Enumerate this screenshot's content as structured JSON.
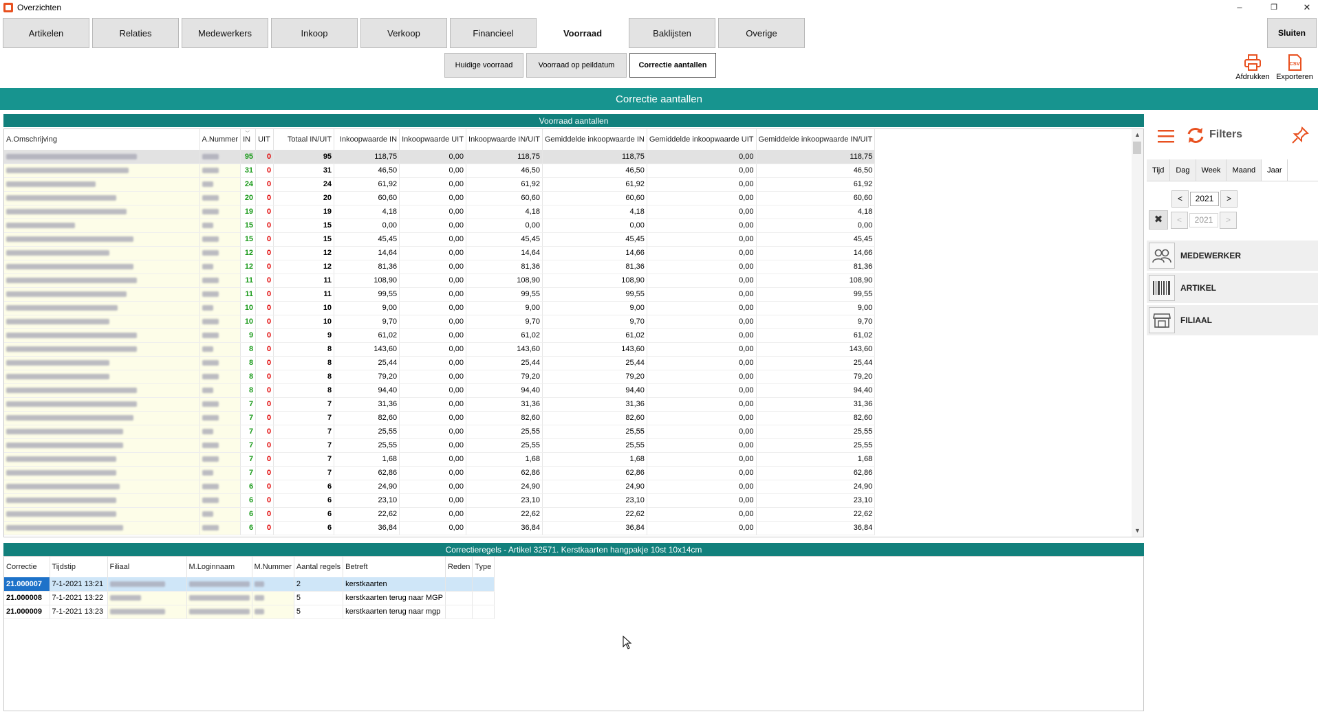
{
  "window": {
    "title": "Overzichten",
    "minimize": "–",
    "restore": "❐",
    "close": "✕"
  },
  "nav": {
    "tabs": [
      "Artikelen",
      "Relaties",
      "Medewerkers",
      "Inkoop",
      "Verkoop",
      "Financieel",
      "Voorraad",
      "Baklijsten",
      "Overige"
    ],
    "active": "Voorraad",
    "close_label": "Sluiten"
  },
  "subnav": {
    "tabs": [
      "Huidige voorraad",
      "Voorraad op peildatum",
      "Correctie aantallen"
    ],
    "active": "Correctie aantallen"
  },
  "actions": {
    "print": "Afdrukken",
    "export": "Exporteren",
    "export_icon_text": "CSV"
  },
  "header": {
    "title": "Correctie aantallen"
  },
  "stock": {
    "title": "Voorraad aantallen",
    "columns": [
      "A.Omschrijving",
      "A.Nummer",
      "IN",
      "UIT",
      "Totaal IN/UIT",
      "Inkoopwaarde IN",
      "Inkoopwaarde UIT",
      "Inkoopwaarde IN/UIT",
      "Gemiddelde inkoopwaarde IN",
      "Gemiddelde inkoopwaarde UIT",
      "Gemiddelde inkoopwaarde IN/UIT"
    ],
    "rows": [
      {
        "in": "95",
        "uit": "0",
        "tot": "95",
        "iv_in": "118,75",
        "iv_uit": "0,00",
        "iv_inuit": "118,75",
        "g_in": "118,75",
        "g_uit": "0,00",
        "g_inuit": "118,75"
      },
      {
        "in": "31",
        "uit": "0",
        "tot": "31",
        "iv_in": "46,50",
        "iv_uit": "0,00",
        "iv_inuit": "46,50",
        "g_in": "46,50",
        "g_uit": "0,00",
        "g_inuit": "46,50"
      },
      {
        "in": "24",
        "uit": "0",
        "tot": "24",
        "iv_in": "61,92",
        "iv_uit": "0,00",
        "iv_inuit": "61,92",
        "g_in": "61,92",
        "g_uit": "0,00",
        "g_inuit": "61,92"
      },
      {
        "in": "20",
        "uit": "0",
        "tot": "20",
        "iv_in": "60,60",
        "iv_uit": "0,00",
        "iv_inuit": "60,60",
        "g_in": "60,60",
        "g_uit": "0,00",
        "g_inuit": "60,60"
      },
      {
        "in": "19",
        "uit": "0",
        "tot": "19",
        "iv_in": "4,18",
        "iv_uit": "0,00",
        "iv_inuit": "4,18",
        "g_in": "4,18",
        "g_uit": "0,00",
        "g_inuit": "4,18"
      },
      {
        "in": "15",
        "uit": "0",
        "tot": "15",
        "iv_in": "0,00",
        "iv_uit": "0,00",
        "iv_inuit": "0,00",
        "g_in": "0,00",
        "g_uit": "0,00",
        "g_inuit": "0,00"
      },
      {
        "in": "15",
        "uit": "0",
        "tot": "15",
        "iv_in": "45,45",
        "iv_uit": "0,00",
        "iv_inuit": "45,45",
        "g_in": "45,45",
        "g_uit": "0,00",
        "g_inuit": "45,45"
      },
      {
        "in": "12",
        "uit": "0",
        "tot": "12",
        "iv_in": "14,64",
        "iv_uit": "0,00",
        "iv_inuit": "14,64",
        "g_in": "14,66",
        "g_uit": "0,00",
        "g_inuit": "14,66"
      },
      {
        "in": "12",
        "uit": "0",
        "tot": "12",
        "iv_in": "81,36",
        "iv_uit": "0,00",
        "iv_inuit": "81,36",
        "g_in": "81,36",
        "g_uit": "0,00",
        "g_inuit": "81,36"
      },
      {
        "in": "11",
        "uit": "0",
        "tot": "11",
        "iv_in": "108,90",
        "iv_uit": "0,00",
        "iv_inuit": "108,90",
        "g_in": "108,90",
        "g_uit": "0,00",
        "g_inuit": "108,90"
      },
      {
        "in": "11",
        "uit": "0",
        "tot": "11",
        "iv_in": "99,55",
        "iv_uit": "0,00",
        "iv_inuit": "99,55",
        "g_in": "99,55",
        "g_uit": "0,00",
        "g_inuit": "99,55"
      },
      {
        "in": "10",
        "uit": "0",
        "tot": "10",
        "iv_in": "9,00",
        "iv_uit": "0,00",
        "iv_inuit": "9,00",
        "g_in": "9,00",
        "g_uit": "0,00",
        "g_inuit": "9,00"
      },
      {
        "in": "10",
        "uit": "0",
        "tot": "10",
        "iv_in": "9,70",
        "iv_uit": "0,00",
        "iv_inuit": "9,70",
        "g_in": "9,70",
        "g_uit": "0,00",
        "g_inuit": "9,70"
      },
      {
        "in": "9",
        "uit": "0",
        "tot": "9",
        "iv_in": "61,02",
        "iv_uit": "0,00",
        "iv_inuit": "61,02",
        "g_in": "61,02",
        "g_uit": "0,00",
        "g_inuit": "61,02"
      },
      {
        "in": "8",
        "uit": "0",
        "tot": "8",
        "iv_in": "143,60",
        "iv_uit": "0,00",
        "iv_inuit": "143,60",
        "g_in": "143,60",
        "g_uit": "0,00",
        "g_inuit": "143,60"
      },
      {
        "in": "8",
        "uit": "0",
        "tot": "8",
        "iv_in": "25,44",
        "iv_uit": "0,00",
        "iv_inuit": "25,44",
        "g_in": "25,44",
        "g_uit": "0,00",
        "g_inuit": "25,44"
      },
      {
        "in": "8",
        "uit": "0",
        "tot": "8",
        "iv_in": "79,20",
        "iv_uit": "0,00",
        "iv_inuit": "79,20",
        "g_in": "79,20",
        "g_uit": "0,00",
        "g_inuit": "79,20"
      },
      {
        "in": "8",
        "uit": "0",
        "tot": "8",
        "iv_in": "94,40",
        "iv_uit": "0,00",
        "iv_inuit": "94,40",
        "g_in": "94,40",
        "g_uit": "0,00",
        "g_inuit": "94,40"
      },
      {
        "in": "7",
        "uit": "0",
        "tot": "7",
        "iv_in": "31,36",
        "iv_uit": "0,00",
        "iv_inuit": "31,36",
        "g_in": "31,36",
        "g_uit": "0,00",
        "g_inuit": "31,36"
      },
      {
        "in": "7",
        "uit": "0",
        "tot": "7",
        "iv_in": "82,60",
        "iv_uit": "0,00",
        "iv_inuit": "82,60",
        "g_in": "82,60",
        "g_uit": "0,00",
        "g_inuit": "82,60"
      },
      {
        "in": "7",
        "uit": "0",
        "tot": "7",
        "iv_in": "25,55",
        "iv_uit": "0,00",
        "iv_inuit": "25,55",
        "g_in": "25,55",
        "g_uit": "0,00",
        "g_inuit": "25,55"
      },
      {
        "in": "7",
        "uit": "0",
        "tot": "7",
        "iv_in": "25,55",
        "iv_uit": "0,00",
        "iv_inuit": "25,55",
        "g_in": "25,55",
        "g_uit": "0,00",
        "g_inuit": "25,55"
      },
      {
        "in": "7",
        "uit": "0",
        "tot": "7",
        "iv_in": "1,68",
        "iv_uit": "0,00",
        "iv_inuit": "1,68",
        "g_in": "1,68",
        "g_uit": "0,00",
        "g_inuit": "1,68"
      },
      {
        "in": "7",
        "uit": "0",
        "tot": "7",
        "iv_in": "62,86",
        "iv_uit": "0,00",
        "iv_inuit": "62,86",
        "g_in": "62,86",
        "g_uit": "0,00",
        "g_inuit": "62,86"
      },
      {
        "in": "6",
        "uit": "0",
        "tot": "6",
        "iv_in": "24,90",
        "iv_uit": "0,00",
        "iv_inuit": "24,90",
        "g_in": "24,90",
        "g_uit": "0,00",
        "g_inuit": "24,90"
      },
      {
        "in": "6",
        "uit": "0",
        "tot": "6",
        "iv_in": "23,10",
        "iv_uit": "0,00",
        "iv_inuit": "23,10",
        "g_in": "23,10",
        "g_uit": "0,00",
        "g_inuit": "23,10"
      },
      {
        "in": "6",
        "uit": "0",
        "tot": "6",
        "iv_in": "22,62",
        "iv_uit": "0,00",
        "iv_inuit": "22,62",
        "g_in": "22,62",
        "g_uit": "0,00",
        "g_inuit": "22,62"
      },
      {
        "in": "6",
        "uit": "0",
        "tot": "6",
        "iv_in": "36,84",
        "iv_uit": "0,00",
        "iv_inuit": "36,84",
        "g_in": "36,84",
        "g_uit": "0,00",
        "g_inuit": "36,84"
      }
    ]
  },
  "corrections": {
    "title": "Correctieregels - Artikel 32571. Kerstkaarten hangpakje 10st 10x14cm",
    "columns": [
      "Correctie",
      "Tijdstip",
      "Filiaal",
      "M.Loginnaam",
      "M.Nummer",
      "Aantal regels",
      "Betreft",
      "Reden",
      "Type"
    ],
    "rows": [
      {
        "correctie": "21.000007",
        "tijdstip": "7-1-2021 13:21",
        "aantal": "2",
        "betreft": "kerstkaarten",
        "reden": "",
        "type": ""
      },
      {
        "correctie": "21.000008",
        "tijdstip": "7-1-2021 13:22",
        "aantal": "5",
        "betreft": "kerstkaarten terug naar MGP",
        "reden": "",
        "type": ""
      },
      {
        "correctie": "21.000009",
        "tijdstip": "7-1-2021 13:23",
        "aantal": "5",
        "betreft": "kerstkaarten terug naar mgp",
        "reden": "",
        "type": ""
      }
    ]
  },
  "filters": {
    "label": "Filters",
    "period_tabs": [
      "Tijd",
      "Dag",
      "Week",
      "Maand",
      "Jaar"
    ],
    "active_period": "Jaar",
    "year_from": "2021",
    "year_to": "2021",
    "prev": "<",
    "next": ">",
    "clear": "✖",
    "sections": [
      "MEDEWERKER",
      "ARTIKEL",
      "FILIAAL"
    ]
  },
  "colors": {
    "header": "#17948f",
    "grid_title": "#12807c",
    "in_value": "#1a9a1a",
    "uit_value": "#e00000",
    "accent_icon": "#e8501f",
    "selection": "#1e72c9"
  }
}
